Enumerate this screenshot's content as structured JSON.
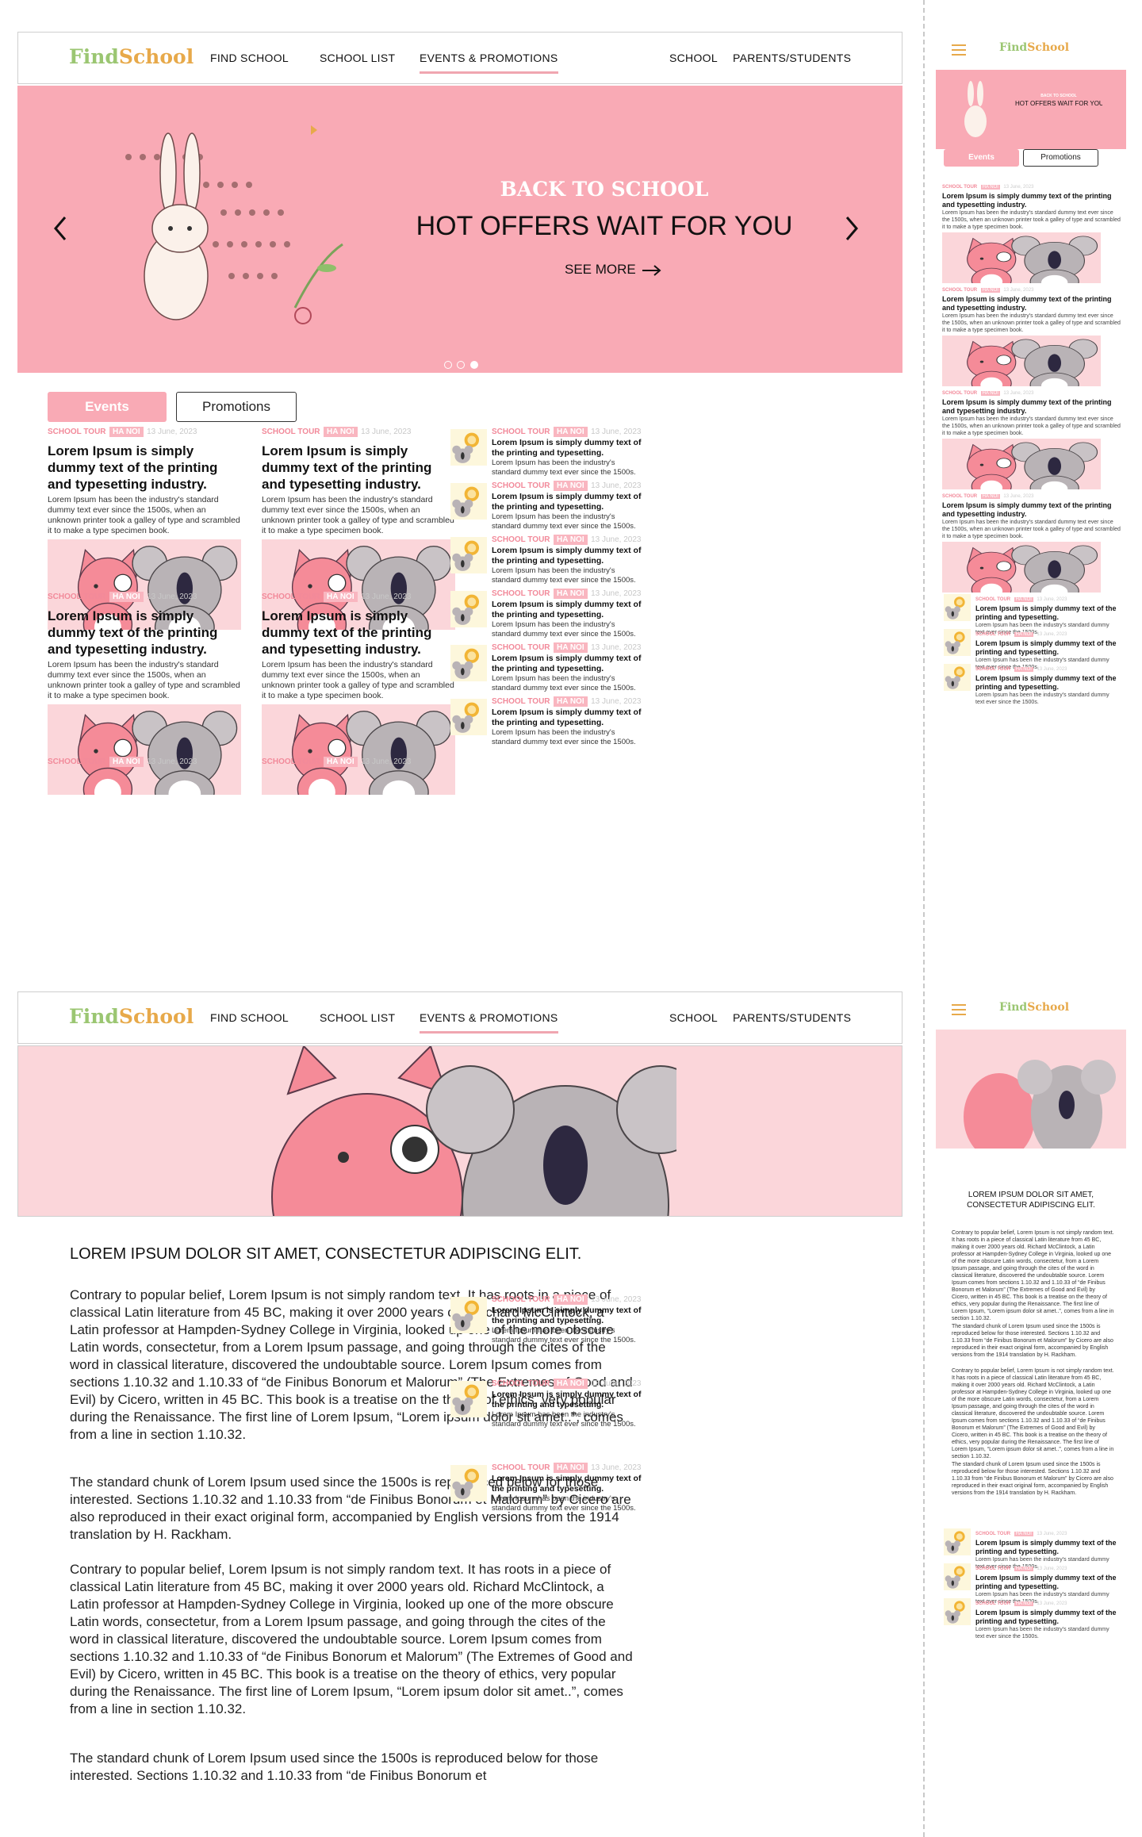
{
  "nav": {
    "logo_find": "Find",
    "logo_school": "School",
    "find_school": "FIND SCHOOL",
    "school_list": "SCHOOL LIST",
    "events_promotions": "EVENTS & PROMOTIONS",
    "school": "SCHOOL",
    "parents_students": "PARENTS/STUDENTS"
  },
  "hero": {
    "kicker": "BACK TO SCHOOL",
    "headline": "HOT OFFERS WAIT FOR YOU",
    "cta": "SEE MORE",
    "slides": 3,
    "active_slide": 3
  },
  "tabs": {
    "events": "Events",
    "promotions": "Promotions"
  },
  "card": {
    "category": "SCHOOL TOUR",
    "location": "HA NOI",
    "date": "13 June, 2023",
    "title": "Lorem Ipsum is simply dummy text of the printing and typesetting industry.",
    "desc": "Lorem Ipsum has been the industry's standard dummy text ever since the 1500s, when an unknown printer took a galley of type and scrambled it to make a type specimen book."
  },
  "side_item": {
    "category": "SCHOOL TOUR",
    "location": "HA NOI",
    "date": "13 June, 2023",
    "title": "Lorem Ipsum is simply dummy text of the printing and typesetting.",
    "desc": "Lorem Ipsum has been the industry's standard dummy text ever since the 1500s."
  },
  "article": {
    "title": "LOREM IPSUM DOLOR SIT AMET, CONSECTETUR ADIPISCING ELIT.",
    "p1": "Contrary to popular belief, Lorem Ipsum is not simply random text. It has roots in a piece of classical Latin literature from 45 BC, making it over 2000 years old. Richard McClintock, a Latin professor at Hampden-Sydney College in Virginia, looked up one of the more obscure Latin words, consectetur, from a Lorem Ipsum passage, and going through the cites of the word in classical literature, discovered the undoubtable source. Lorem Ipsum comes from sections 1.10.32 and 1.10.33 of “de Finibus Bonorum et Malorum” (The Extremes of Good and Evil) by Cicero, written in 45 BC. This book is a treatise on the theory of ethics, very popular during the Renaissance. The first line of Lorem Ipsum, “Lorem ipsum dolor sit amet..”, comes from a line in section 1.10.32.",
    "p2": "The standard chunk of Lorem Ipsum used since the 1500s is reproduced below for those interested. Sections 1.10.32 and 1.10.33 from “de Finibus Bonorum et Malorum” by Cicero are also reproduced in their exact original form, accompanied by English versions from the 1914 translation by H. Rackham.",
    "p4_partial": "The standard chunk of Lorem Ipsum used since the 1500s is reproduced below for those interested. Sections 1.10.32 and 1.10.33 from “de Finibus Bonorum et",
    "mobile_title": "LOREM IPSUM DOLOR SIT AMET, CONSECTETUR ADIPISCING ELIT."
  },
  "colors": {
    "pink": "#f9aab5",
    "pale_pink": "#fbd6da",
    "logo_green": "#9bc672",
    "logo_orange": "#e7a94a"
  },
  "icons": [
    "chevron-left-icon",
    "chevron-right-icon",
    "arrow-right-icon",
    "hamburger-icon",
    "cat-koala-illustration",
    "bunny-illustration",
    "lion-koala-thumbnail"
  ]
}
